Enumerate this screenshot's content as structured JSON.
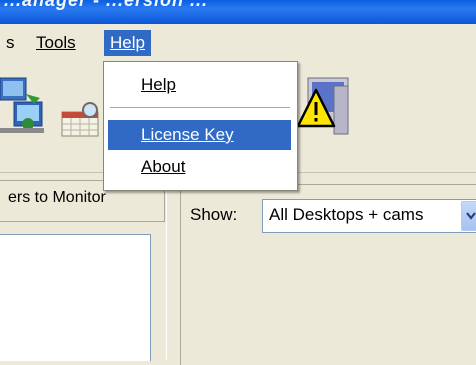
{
  "window": {
    "title_fragment": "...anager - ...ersion ..."
  },
  "menubar": {
    "items": [
      {
        "label": "s"
      },
      {
        "label": "Tools"
      },
      {
        "label": "Help"
      }
    ]
  },
  "help_menu": {
    "items": [
      {
        "label": "Help"
      },
      {
        "label": "License Key"
      },
      {
        "label": "About"
      }
    ]
  },
  "left_panel": {
    "header": "ers to Monitor"
  },
  "filter": {
    "label": "Show:",
    "value": "All Desktops + cams"
  },
  "colors": {
    "highlight": "#316ac5",
    "titlebar": "#0a56d8",
    "face": "#ece9d8"
  },
  "icons": [
    "computers-network-icon",
    "calendar-search-icon",
    "warning-computer-icon"
  ]
}
